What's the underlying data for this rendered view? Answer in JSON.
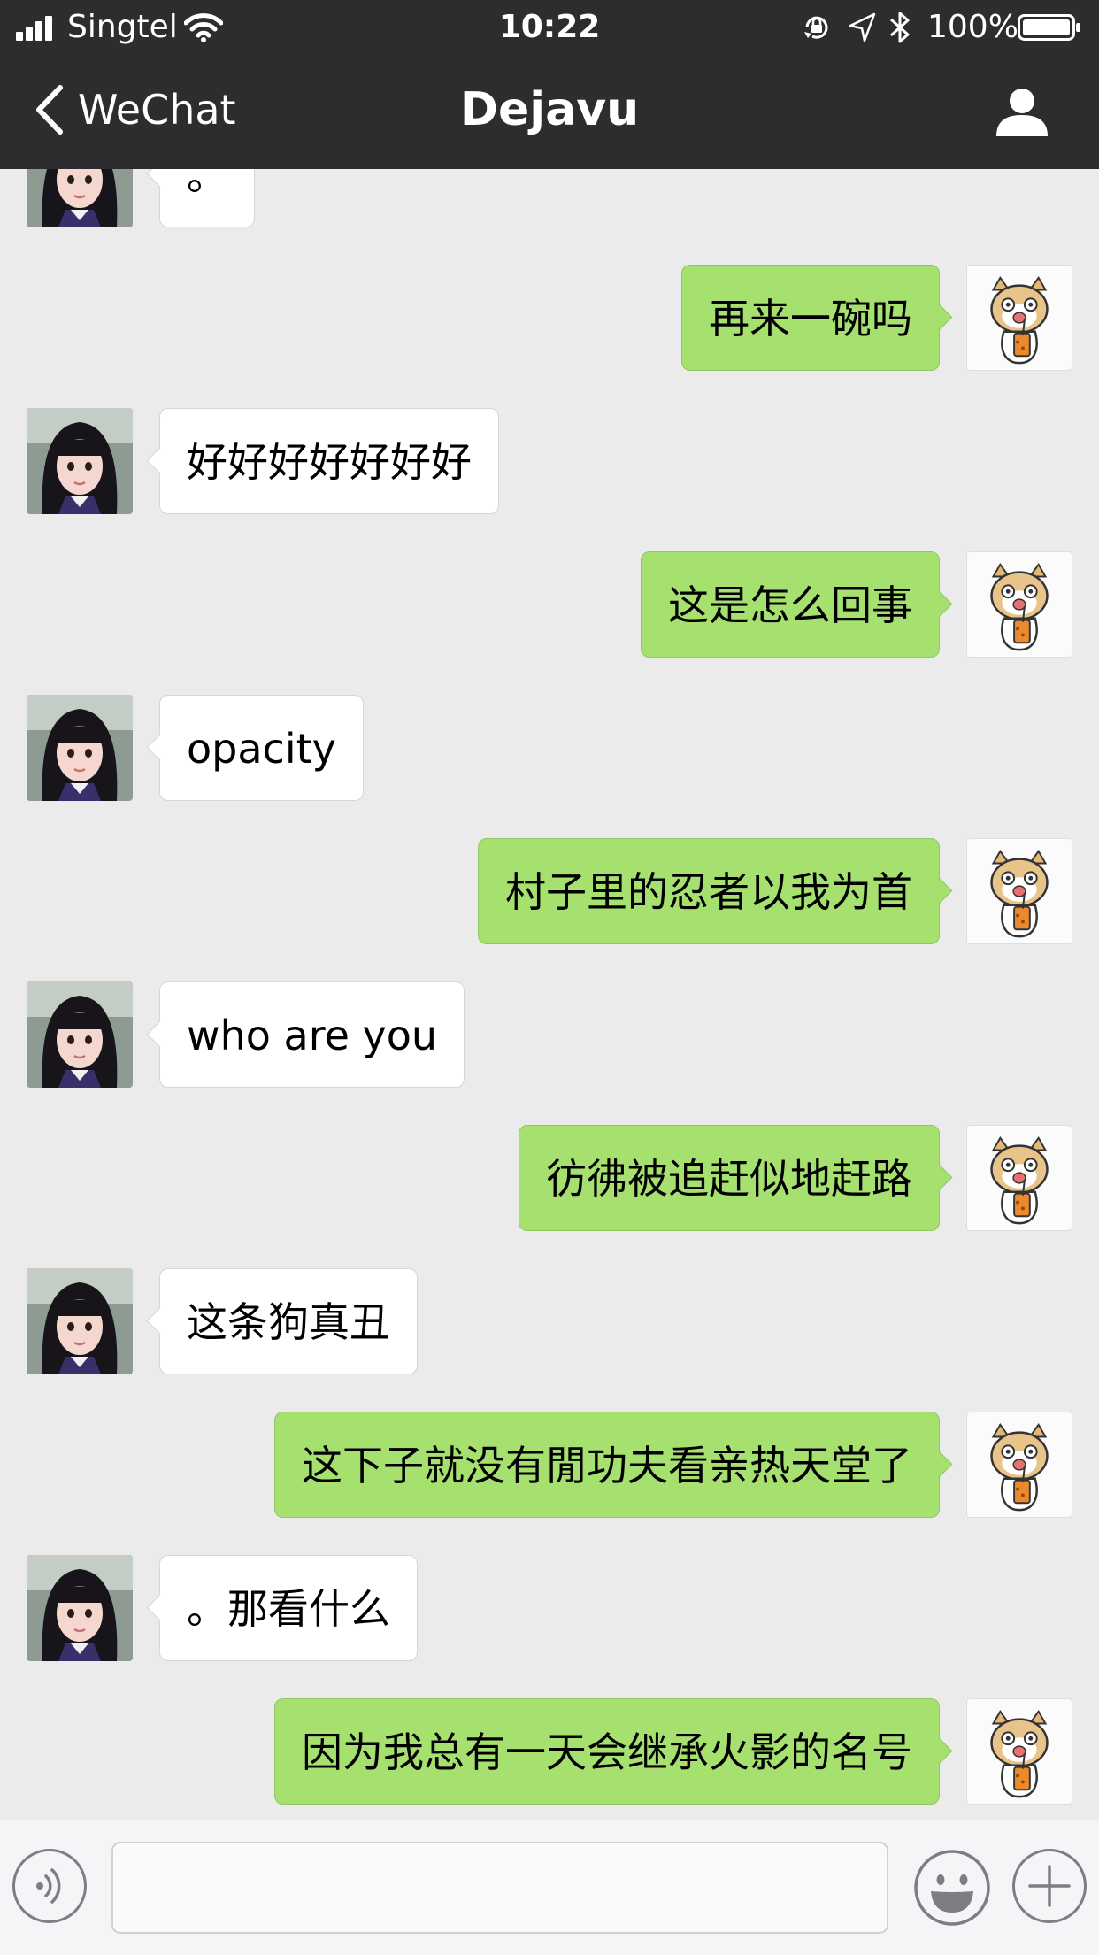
{
  "status_bar": {
    "carrier": "Singtel",
    "time": "10:22",
    "battery_percent": "100%",
    "icons": [
      "signal-icon",
      "wifi-icon",
      "orientation-lock-icon",
      "location-icon",
      "bluetooth-icon",
      "battery-icon"
    ]
  },
  "nav": {
    "back_label": "WeChat",
    "title": "Dejavu",
    "back_icon": "chevron-left-icon",
    "profile_icon": "person-icon"
  },
  "colors": {
    "nav_background": "#2d2d30",
    "chat_background": "#ebebeb",
    "outgoing_bubble": "#a6e16f",
    "incoming_bubble": "#ffffff"
  },
  "messages": [
    {
      "side": "in",
      "text": "。"
    },
    {
      "side": "out",
      "text": "再来一碗吗"
    },
    {
      "side": "in",
      "text": "好好好好好好好"
    },
    {
      "side": "out",
      "text": "这是怎么回事"
    },
    {
      "side": "in",
      "text": "opacity"
    },
    {
      "side": "out",
      "text": "村子里的忍者以我为首"
    },
    {
      "side": "in",
      "text": "who are you"
    },
    {
      "side": "out",
      "text": "彷彿被追赶似地赶路"
    },
    {
      "side": "in",
      "text": "这条狗真丑"
    },
    {
      "side": "out",
      "text": "这下子就没有閒功夫看亲热天堂了"
    },
    {
      "side": "in",
      "text": "。那看什么"
    },
    {
      "side": "out",
      "text": "因为我总有一天会继承火影的名号"
    }
  ],
  "input_bar": {
    "voice_icon": "voice-icon",
    "text_value": "",
    "emoji_icon": "emoji-icon",
    "plus_icon": "plus-icon"
  }
}
